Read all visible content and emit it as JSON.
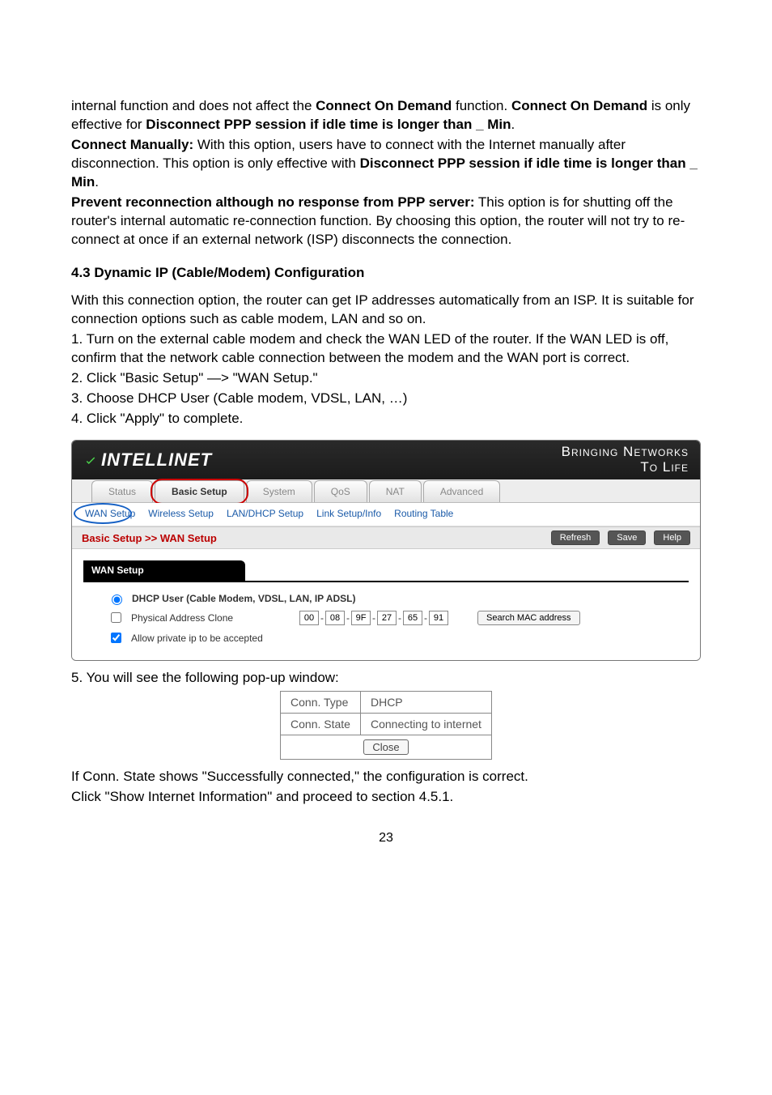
{
  "body": {
    "para1_pre": "internal function and does not affect the ",
    "para1_b1": "Connect On Demand",
    "para1_mid": " function. ",
    "para1_b2": "Connect On Demand",
    "para1_mid2": " is only effective for ",
    "para1_b3": "Disconnect PPP session if idle time is longer than _ Min",
    "para1_post": ".",
    "cm_label": "Connect Manually:",
    "cm_text1": " With this option, users have to connect with the Internet manually after disconnection. This option is only effective with ",
    "cm_b1": "Disconnect PPP session if idle time is longer than _ Min",
    "cm_post": ".",
    "pr_label": "Prevent reconnection although no response from PPP server:",
    "pr_text": " This option is for shutting off the router's internal automatic re-connection function. By choosing this option, the router will not try to re-connect at once if an external network (ISP) disconnects the connection.",
    "heading43": "4.3 Dynamic IP (Cable/Modem) Configuration",
    "intro43": "With this connection option, the router can get IP addresses automatically from an ISP. It is suitable for connection options such as cable modem, LAN and so on.",
    "step1": "1. Turn on the external cable modem and check the WAN LED of the router. If the WAN LED is off, confirm that the network cable connection between the modem and the WAN port is correct.",
    "step2": "2. Click \"Basic Setup\" —> \"WAN Setup.\"",
    "step3": "3. Choose DHCP User (Cable modem, VDSL, LAN, …)",
    "step4": "4. Click \"Apply\" to complete.",
    "step5": "5. You will see the following pop-up window:",
    "closing1": "If Conn. State shows \"Successfully connected,\" the configuration is correct.",
    "closing2": "Click \"Show Internet Information\" and proceed to section 4.5.1.",
    "page_number": "23"
  },
  "router": {
    "brand": "INTELLINET",
    "tag1": "Bringing Networks",
    "tag2": "To Life",
    "tabs": {
      "status": "Status",
      "basic": "Basic Setup",
      "system": "System",
      "qos": "QoS",
      "nat": "NAT",
      "advanced": "Advanced"
    },
    "subtabs": {
      "wan": "WAN Setup",
      "wireless": "Wireless Setup",
      "landhcp": "LAN/DHCP Setup",
      "link": "Link Setup/Info",
      "routing": "Routing Table"
    },
    "crumb": "Basic Setup >> WAN Setup",
    "actions": {
      "refresh": "Refresh",
      "save": "Save",
      "help": "Help"
    },
    "panel_title": "WAN Setup",
    "form": {
      "dhcp_radio": "DHCP User (Cable Modem, VDSL, LAN, IP ADSL)",
      "pac_label": "Physical Address Clone",
      "mac": [
        "00",
        "08",
        "9F",
        "27",
        "65",
        "91"
      ],
      "search_mac": "Search MAC address",
      "allow_priv": "Allow private ip to be accepted"
    }
  },
  "popup": {
    "r1c1": "Conn. Type",
    "r1c2": "DHCP",
    "r2c1": "Conn. State",
    "r2c2": "Connecting to internet",
    "close": "Close"
  }
}
